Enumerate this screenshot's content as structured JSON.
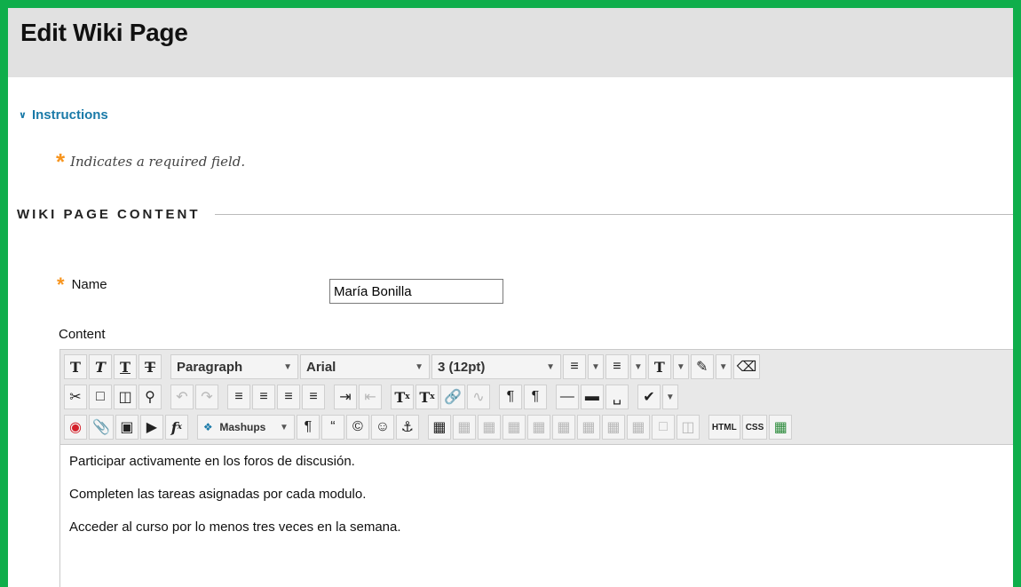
{
  "page": {
    "title": "Edit Wiki Page"
  },
  "instructions": {
    "label": "Instructions"
  },
  "required_note": {
    "star": "*",
    "text": "Indicates a required field."
  },
  "section": {
    "title": "WIKI PAGE CONTENT"
  },
  "name_field": {
    "label": "Name",
    "value": "María Bonilla"
  },
  "content_field": {
    "label": "Content"
  },
  "toolbar": {
    "format_block": "Paragraph",
    "font_family": "Arial",
    "font_size": "3 (12pt)",
    "mashups": "Mashups",
    "html": "HTML",
    "css": "CSS"
  },
  "content": {
    "paragraphs": [
      "Participar activamente en los foros de discusión.",
      "Completen las tareas asignadas por cada modulo.",
      "Acceder al curso por lo menos tres veces en la semana."
    ]
  },
  "colors": {
    "frame": "#0fae4b",
    "accent": "#1a7aa8",
    "required": "#f7941d"
  }
}
